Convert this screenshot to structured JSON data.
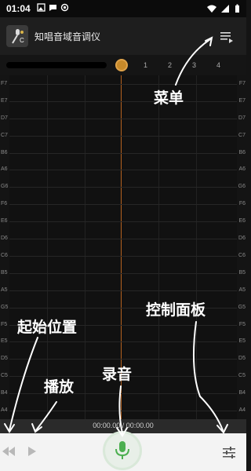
{
  "status": {
    "time": "01:04"
  },
  "app": {
    "title": "知唱音域音调仪",
    "logo_text": "C"
  },
  "timeline": {
    "bars": [
      "1",
      "2",
      "3",
      "4"
    ]
  },
  "notes": [
    "F7",
    "E7",
    "D7",
    "C7",
    "B6",
    "A6",
    "G6",
    "F6",
    "E6",
    "D6",
    "C6",
    "B5",
    "A5",
    "G5",
    "F5",
    "E5",
    "D5",
    "C5",
    "B4",
    "A4"
  ],
  "player": {
    "time_display": "00:00.00 / 00:00.00"
  },
  "annotations": {
    "menu": "菜单",
    "start_position": "起始位置",
    "play": "播放",
    "record": "录音",
    "control_panel": "控制面板"
  },
  "colors": {
    "accent": "#c88a2a",
    "mic": "#4caf50",
    "playhead": "#b5621f"
  }
}
